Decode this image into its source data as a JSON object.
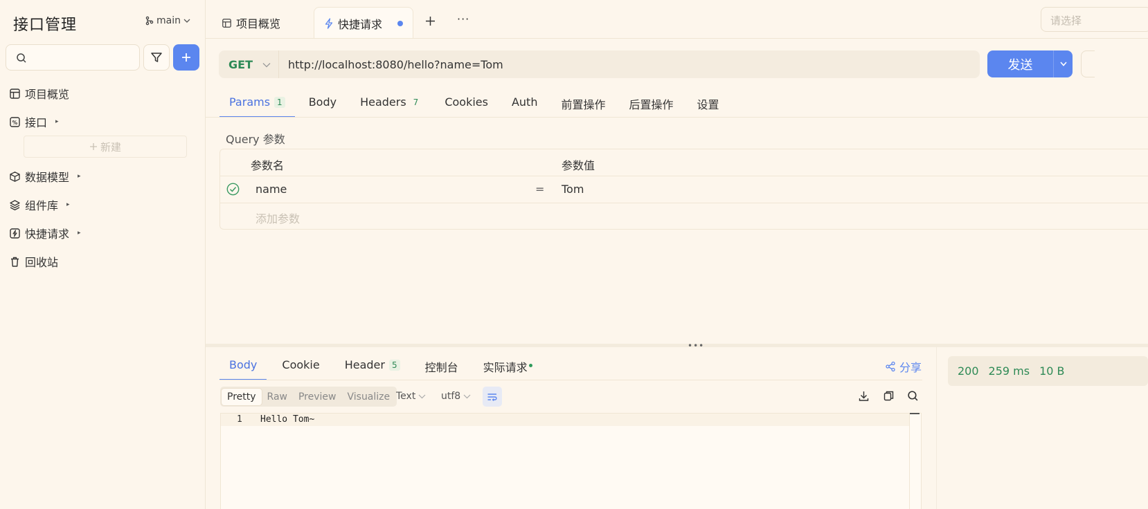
{
  "sidebar": {
    "title": "接口管理",
    "branch": "main",
    "new_label": "新建",
    "items": [
      {
        "label": "项目概览",
        "icon": "layout-icon"
      },
      {
        "label": "接口",
        "icon": "api-icon",
        "caret": "▸"
      },
      {
        "label": "数据模型",
        "icon": "cube-icon",
        "caret": "▸"
      },
      {
        "label": "组件库",
        "icon": "layers-icon",
        "caret": "▸"
      },
      {
        "label": "快捷请求",
        "icon": "bolt-icon",
        "caret": "▸"
      },
      {
        "label": "回收站",
        "icon": "trash-icon"
      }
    ]
  },
  "tabs": {
    "overview": "项目概览",
    "quick_request": "快捷请求",
    "more": "···",
    "env_placeholder": "请选择"
  },
  "request": {
    "method": "GET",
    "url": "http://localhost:8080/hello?name=Tom",
    "send_label": "发送",
    "tabs": [
      {
        "label": "Params",
        "badge": "1"
      },
      {
        "label": "Body",
        "badge": ""
      },
      {
        "label": "Headers",
        "badge": "7"
      },
      {
        "label": "Cookies",
        "badge": ""
      },
      {
        "label": "Auth",
        "badge": ""
      },
      {
        "label": "前置操作",
        "badge": ""
      },
      {
        "label": "后置操作",
        "badge": ""
      },
      {
        "label": "设置",
        "badge": ""
      }
    ],
    "query_label": "Query 参数",
    "col_name": "参数名",
    "col_value": "参数值",
    "params": [
      {
        "name": "name",
        "eq": "=",
        "value": "Tom",
        "enabled": true
      }
    ],
    "add_param": "添加参数"
  },
  "response": {
    "tabs": [
      {
        "label": "Body",
        "badge": ""
      },
      {
        "label": "Cookie",
        "badge": ""
      },
      {
        "label": "Header",
        "badge": "5"
      },
      {
        "label": "控制台",
        "badge": ""
      },
      {
        "label": "实际请求",
        "badge": ""
      }
    ],
    "share": "分享",
    "formats": [
      "Pretty",
      "Raw",
      "Preview",
      "Visualize"
    ],
    "content_type": "Text",
    "encoding": "utf8",
    "line_number": "1",
    "body": "Hello Tom~",
    "status_code": "200",
    "time": "259 ms",
    "size": "10 B"
  },
  "colors": {
    "accent": "#5b86ef",
    "success": "#2e8a56",
    "background": "#fdf6ec"
  }
}
